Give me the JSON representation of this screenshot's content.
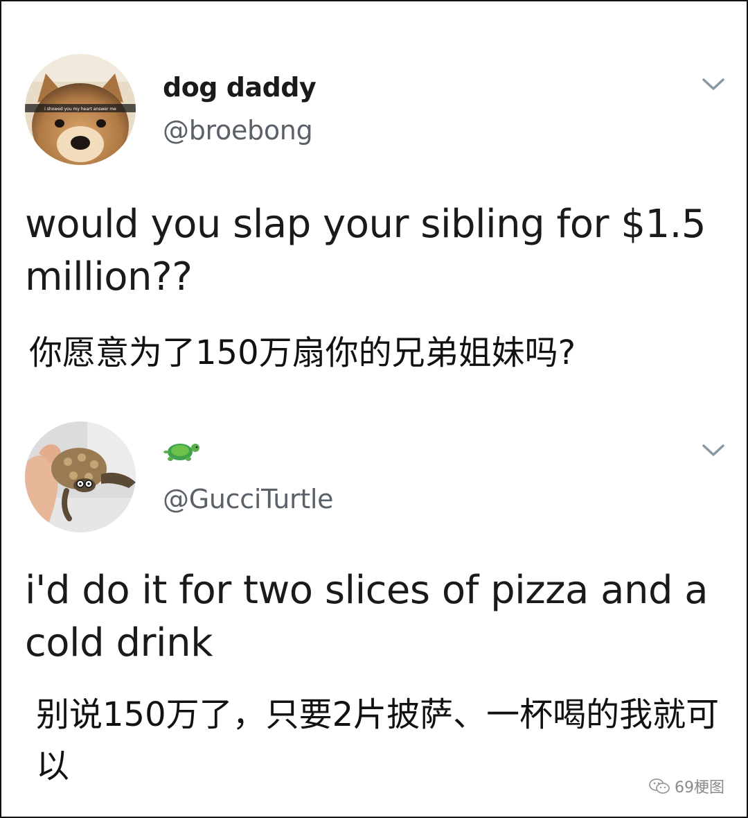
{
  "tweets": [
    {
      "display_name": "dog daddy",
      "handle": "@broebong",
      "text": "would you slap your sibling for $1.5 million??",
      "translation": "你愿意为了150万扇你的兄弟姐妹吗?",
      "avatar_caption": "i showed you my heart answer me",
      "avatar_icon": "dog-avatar",
      "menu_icon": "chevron-down-icon"
    },
    {
      "display_name_icon": "turtle-emoji-icon",
      "handle": "@GucciTurtle",
      "text": "i'd do it for two slices of pizza and a cold drink",
      "translation": "别说150万了，只要2片披萨、一杯喝的我就可以",
      "avatar_icon": "turtle-avatar",
      "menu_icon": "chevron-down-icon"
    }
  ],
  "watermark": {
    "icon": "wechat-icon",
    "label": "69梗图"
  },
  "colors": {
    "text": "#1a1a1a",
    "handle": "#5b6169",
    "chevron": "#8899a6",
    "border": "#111111"
  }
}
